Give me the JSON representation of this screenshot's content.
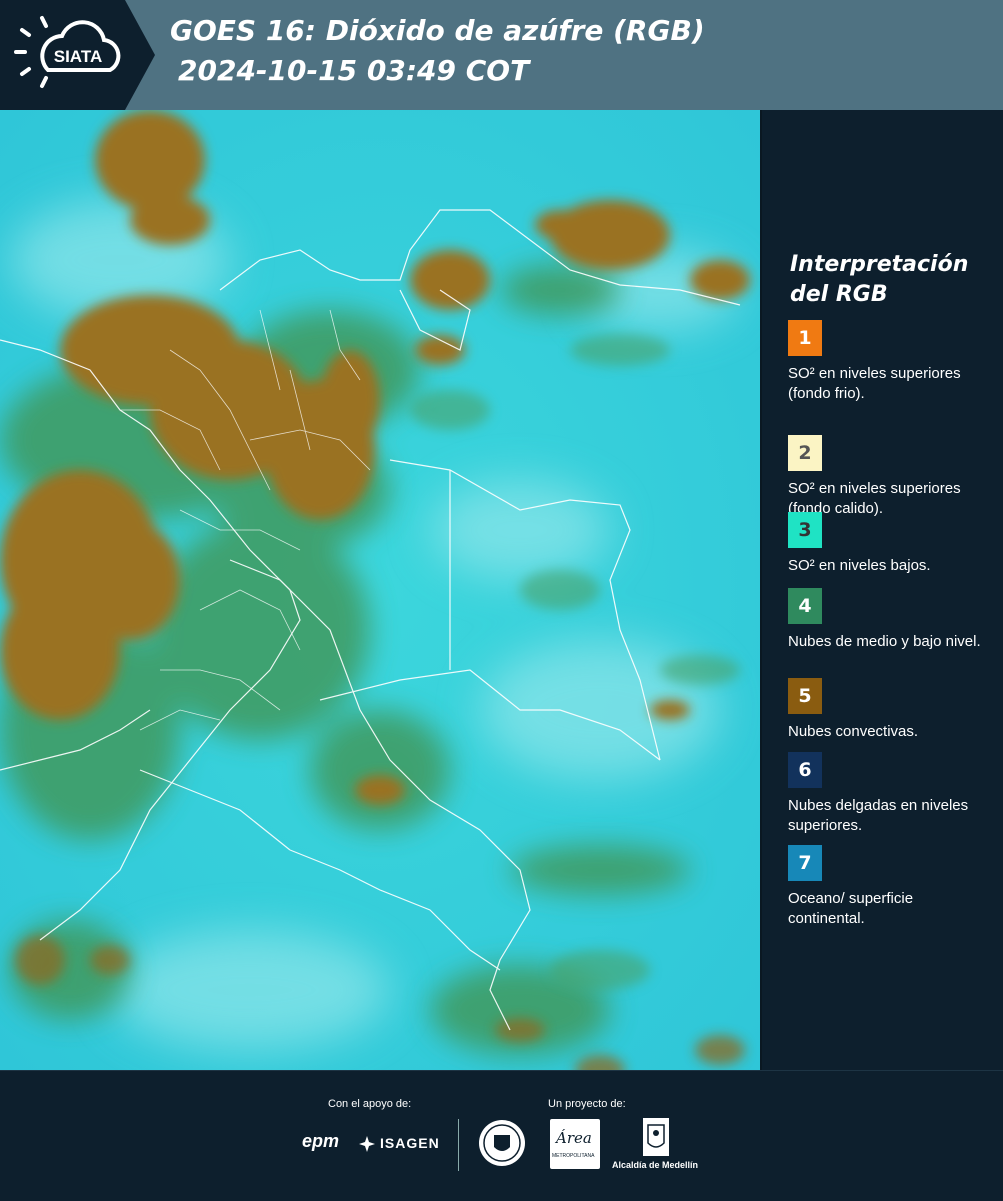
{
  "header": {
    "logo_text": "SIATA",
    "title_line1": "GOES 16: Dióxido de azúfre (RGB)",
    "title_line2": "2024-10-15 03:49 COT"
  },
  "legend": {
    "title_line1": "Interpretación",
    "title_line2": "del RGB",
    "items": [
      {
        "number": "1",
        "color": "#f07a12",
        "number_color": "#ffffff",
        "text": "SO² en niveles superiores (fondo frio)."
      },
      {
        "number": "2",
        "color": "#fbf4c4",
        "number_color": "#555555",
        "text": "SO² en niveles superiores (fondo calido)."
      },
      {
        "number": "3",
        "color": "#1fe3c4",
        "number_color": "#333333",
        "text": "SO² en niveles bajos."
      },
      {
        "number": "4",
        "color": "#2f8a5e",
        "number_color": "#ffffff",
        "text": "Nubes de medio y bajo nivel."
      },
      {
        "number": "5",
        "color": "#8a5c10",
        "number_color": "#ffffff",
        "text": "Nubes convectivas."
      },
      {
        "number": "6",
        "color": "#12325c",
        "number_color": "#ffffff",
        "text": "Nubes delgadas en niveles superiores."
      },
      {
        "number": "7",
        "color": "#1788b8",
        "number_color": "#ffffff",
        "text": "Oceano/ superficie continental."
      }
    ]
  },
  "footer": {
    "support_label": "Con el apoyo de:",
    "project_label": "Un proyecto de:",
    "sponsor1": "epm",
    "sponsor2": "ISAGEN",
    "partner1_text": "Área",
    "partner1_sub": "METROPOLITANA",
    "partner2_text": "Alcaldía de Medellín"
  }
}
